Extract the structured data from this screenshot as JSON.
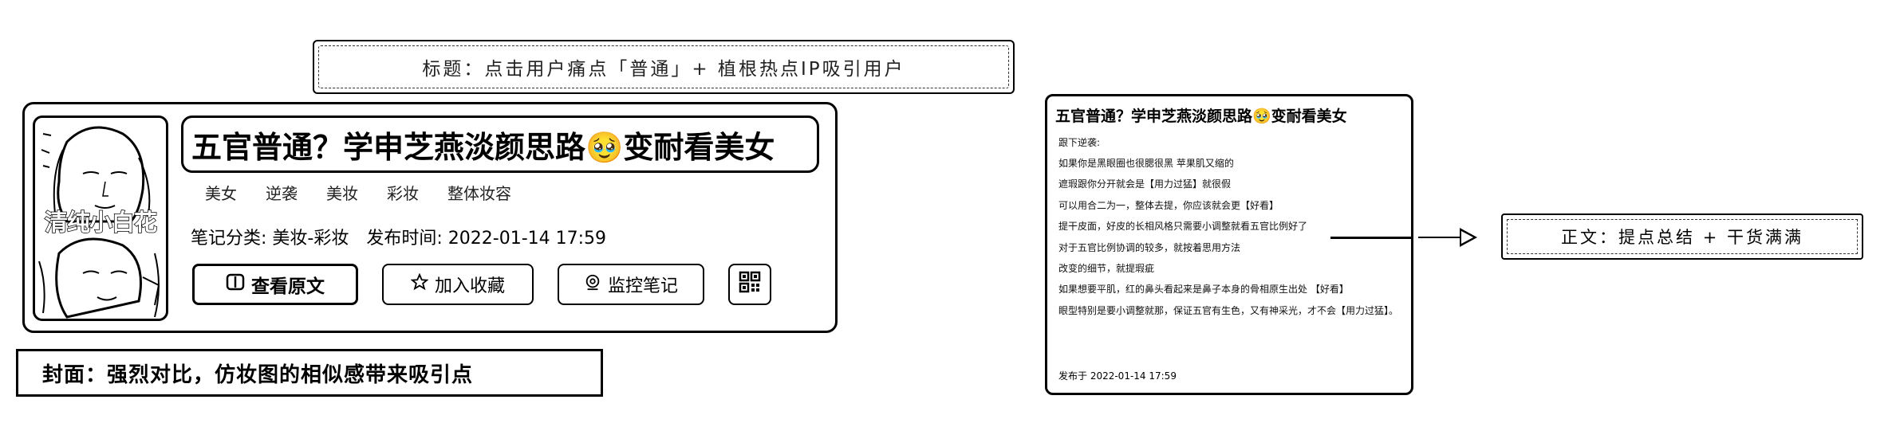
{
  "annotations": {
    "title_note": "标题：点击用户痛点「普通」+ 植根热点IP吸引用户",
    "cover_note": "封面：强烈对比，仿妆图的相似感带来吸引点",
    "body_note": "正文：提点总结 + 干货满满"
  },
  "note": {
    "cover_text": "清纯小白花",
    "title": "五官普通？学申芝燕淡颜思路🥹变耐看美女",
    "tags": [
      "美女",
      "逆袭",
      "美妆",
      "彩妆",
      "整体妆容"
    ],
    "category_label": "笔记分类:",
    "category_value": "美妆-彩妆",
    "published_label": "发布时间:",
    "published_value": "2022-01-14 17:59",
    "buttons": {
      "view_original": "查看原文",
      "add_favorite": "加入收藏",
      "monitor_note": "监控笔记"
    }
  },
  "preview": {
    "title": "五官普通？学申芝燕淡颜思路🥹变耐看美女",
    "lines": [
      "跟下逆袭:",
      "如果你是黑眼圈也很腮很黑 苹果肌又缩的",
      "遮瑕跟你分开就会是【用力过猛】就很假",
      "可以用合二为一，整体去提，你应该就会更【好看】",
      "提干皮面，好皮的长相风格只需要小调整就看五官比例好了",
      "对于五官比例协调的较多，就按着思用方法",
      "改变的细节，就提瑕疵",
      "如果想要平肌，红的鼻头看起来是鼻子本身的骨相原生出处 【好看】",
      "眼型特别是要小调整就那，保证五官有生色，又有神采光，才不会【用力过猛】。"
    ],
    "date": "发布于 2022-01-14 17:59"
  },
  "icons": {
    "view_original": "book-icon",
    "add_favorite": "star-icon",
    "monitor_note": "target-icon",
    "qr": "qr-code-icon",
    "connector": "arrow-right-icon"
  }
}
